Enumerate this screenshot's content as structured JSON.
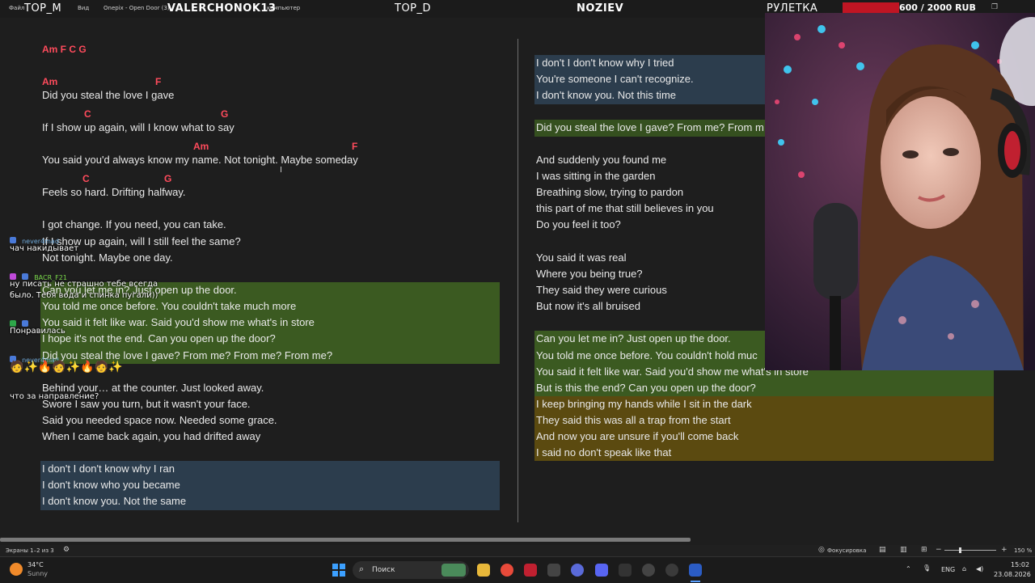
{
  "topbar": {
    "menu": [
      "Файл",
      "Вид",
      "Onepix - Open Door (3)",
      "компьютер"
    ],
    "overlay_titles": [
      "TOP_M",
      "VALERCHONOK13",
      "TOP_D",
      "NOZIEV",
      "РУЛЕТКА"
    ],
    "donation": "600 / 2000 RUB"
  },
  "left": {
    "chords_header": "Am F C G",
    "chord_lines": [
      {
        "a": "Am",
        "b": "F"
      },
      {
        "a": "C",
        "b": "G"
      },
      {
        "a": "Am",
        "b": "F"
      },
      {
        "a": "C",
        "b": "G"
      }
    ],
    "lines": [
      "Did you steal the love I gave",
      "If I show up again, will I know what to say",
      "You said you'd always know my name. Not tonight. Maybe someday",
      "Feels so hard. Drifting halfway.",
      "I got change. If you need, you can take.",
      "If I show up again, will I still feel the same?",
      "Not tonight. Maybe one day.",
      "Can you let me in? Just open up the door.",
      "You told me once before. You couldn't take much more",
      "You said it felt like war. Said you'd show me what's in store",
      "I hope it's not the end. Can you open up the door?",
      "Did you steal the love I gave? From me? From me? From me?",
      "Behind your… at the counter. Just looked away.",
      "Swore I saw you turn, but it wasn't your face.",
      "Said you needed space now. Needed some grace.",
      "When I came back again, you had drifted away",
      "I don't I don't know why I ran",
      "I don't know who you became",
      "I don't know you. Not the same"
    ]
  },
  "right": {
    "lines": [
      "I don't I don't know why I tried",
      "You're someone I can't recognize.",
      "I don't know you. Not this time",
      "Did you steal the love I gave? From me? From m",
      "And suddenly you found me",
      "I was sitting in the garden",
      "Breathing slow, trying to pardon",
      "this part of me that still believes in you",
      "Do you feel it too?",
      "You said it was real",
      "Where you being true?",
      "They said they were curious",
      "But now it's all bruised",
      "Can you let me in? Just open up the door.",
      "You told me once before. You couldn't hold muc",
      "You said it felt like war. Said you'd show me what's in store",
      "But is this the end? Can you open up the door?",
      "I keep bringing my hands while I sit in the dark",
      "They said this was all a trap from the start",
      "And now you are unsure if you'll come back",
      "I said no don't speak like that"
    ]
  },
  "chat": [
    {
      "name": "never4mad",
      "msg": "чач накидывает"
    },
    {
      "name": "BACR_F21",
      "msg": "ну писать не страшно тебе всегда"
    },
    {
      "name": "",
      "msg": "было. Тебя вода и спинка пугали))"
    },
    {
      "name": "",
      "msg": "Понравилась"
    },
    {
      "name": "never4mad",
      "msg": "что за направление?"
    }
  ],
  "status": {
    "screens": "Экраны 1–2 из 3",
    "focus": "Фокусировка",
    "zoom": "150 %"
  },
  "taskbar": {
    "weather_temp": "34°C",
    "weather_desc": "Sunny",
    "search": "Поиск",
    "lang": "ENG",
    "time": "15:02",
    "date": "23.08.2026"
  },
  "colors": {
    "chord": "#ff4b5c",
    "hl_green": "#3b5a21",
    "hl_blue": "#2c3d4d",
    "hl_yellow": "#5b4a10",
    "donation": "#c01523"
  }
}
